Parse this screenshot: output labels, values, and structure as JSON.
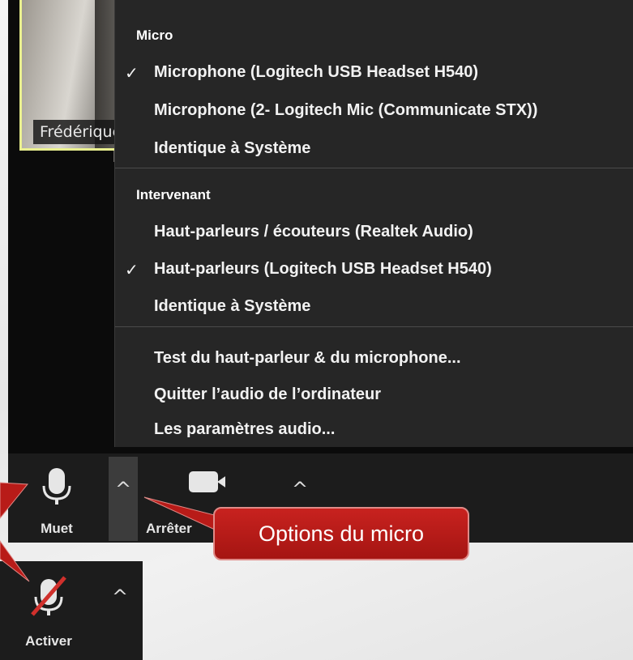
{
  "participant": {
    "name": "Frédérique Duval"
  },
  "audio_menu": {
    "micro_heading": "Micro",
    "micro_items": [
      {
        "label": "Microphone (Logitech USB Headset H540)",
        "checked": true
      },
      {
        "label": "Microphone (2- Logitech Mic (Communicate STX))",
        "checked": false
      },
      {
        "label": "Identique à Système",
        "checked": false
      }
    ],
    "speaker_heading": "Intervenant",
    "speaker_items": [
      {
        "label": "Haut-parleurs / écouteurs (Realtek Audio)",
        "checked": false
      },
      {
        "label": "Haut-parleurs (Logitech USB Headset H540)",
        "checked": true
      },
      {
        "label": "Identique à Système",
        "checked": false
      }
    ],
    "action_items": [
      {
        "label": "Test du haut-parleur & du microphone..."
      },
      {
        "label": "Quitter l’audio de l’ordinateur"
      },
      {
        "label": "Les paramètres audio..."
      }
    ],
    "check_mark": "✓"
  },
  "toolbar": {
    "mute_label": "Muet",
    "stop_video_label": "Arrêter",
    "chevron": "^"
  },
  "muted_panel": {
    "activate_label": "Activer",
    "chevron": "^"
  },
  "callout": {
    "text": "Options du micro"
  },
  "colors": {
    "callout_red": "#b81b18",
    "menu_bg": "#262626",
    "tile_border": "#e9ef8f"
  }
}
